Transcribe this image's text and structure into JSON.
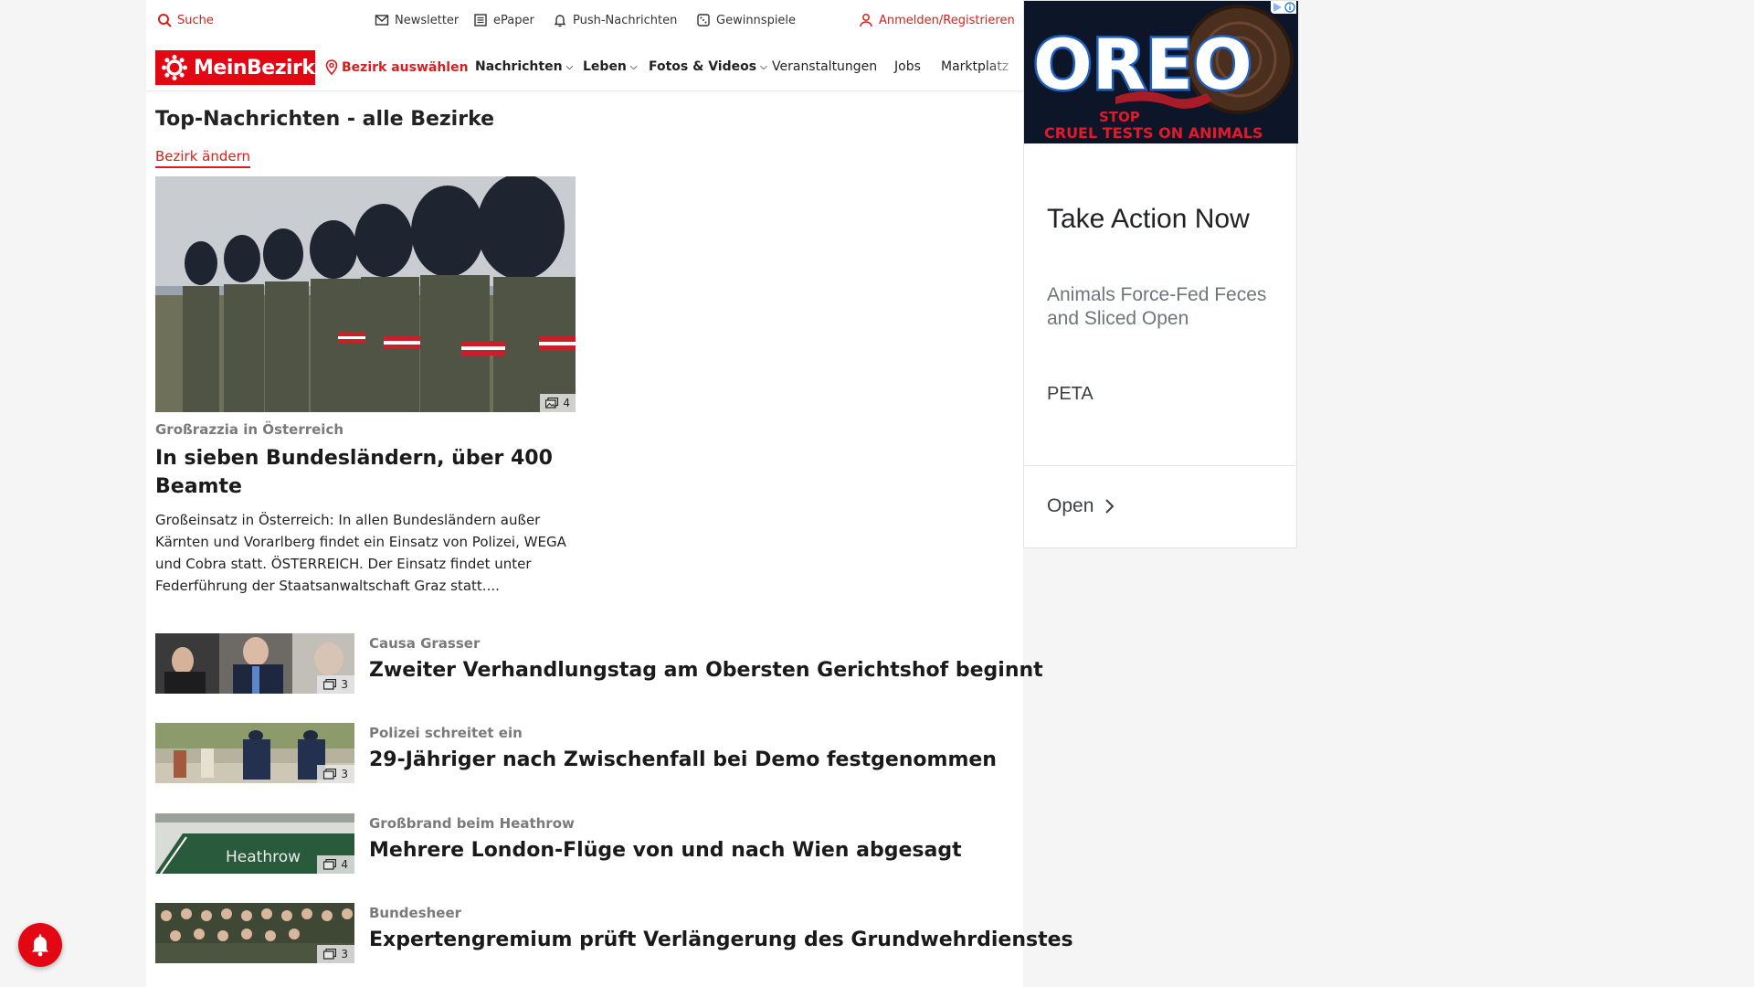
{
  "utility": {
    "search": "Suche",
    "newsletter": "Newsletter",
    "epaper": "ePaper",
    "push": "Push-Nachrichten",
    "gewinnspiele": "Gewinnspiele",
    "login": "Anmelden/Registrieren"
  },
  "nav": {
    "logo": "MeinBezirk",
    "bezirk": "Bezirk auswählen",
    "items": [
      "Nachrichten",
      "Leben",
      "Fotos & Videos",
      "Veranstaltungen",
      "Jobs",
      "Marktplatz"
    ]
  },
  "section": {
    "title": "Top-Nachrichten - alle Bezirke",
    "change": "Bezirk ändern"
  },
  "hero": {
    "kicker": "Großrazzia in Österreich",
    "title": "In sieben Bundesländern, über 400 Beamte",
    "teaser": "Großeinsatz in Österreich: In allen Bundesländern außer Kärnten und Vorarlberg findet ein Einsatz von Polizei, WEGA und Cobra statt. ÖSTERREICH. Der Einsatz findet unter Federführung der Staatsanwaltschaft Graz statt....",
    "photos": "4"
  },
  "articles": [
    {
      "kicker": "Causa Grasser",
      "title": "Zweiter Verhandlungstag am Obersten Gerichtshof beginnt",
      "photos": "3"
    },
    {
      "kicker": "Polizei schreitet ein",
      "title": "29-Jähriger nach Zwischenfall bei Demo festgenommen",
      "photos": "3"
    },
    {
      "kicker": "Großbrand beim Heathrow",
      "title": "Mehrere London-Flüge von und nach Wien abgesagt",
      "photos": "4",
      "thumb_text": "Heathrow"
    },
    {
      "kicker": "Bundesheer",
      "title": "Expertengremium prüft Verlängerung des Grundwehrdienstes",
      "photos": "3"
    }
  ],
  "ad": {
    "banner_logo": "OREO",
    "banner_line1": "STOP",
    "banner_line2": "CRUEL TESTS ON ANIMALS",
    "headline": "Take Action Now",
    "description": "Animals Force-Fed Feces and Sliced Open",
    "brand": "PETA",
    "cta": "Open"
  },
  "colors": {
    "brand": "#e30613",
    "link": "#d81e1e"
  }
}
